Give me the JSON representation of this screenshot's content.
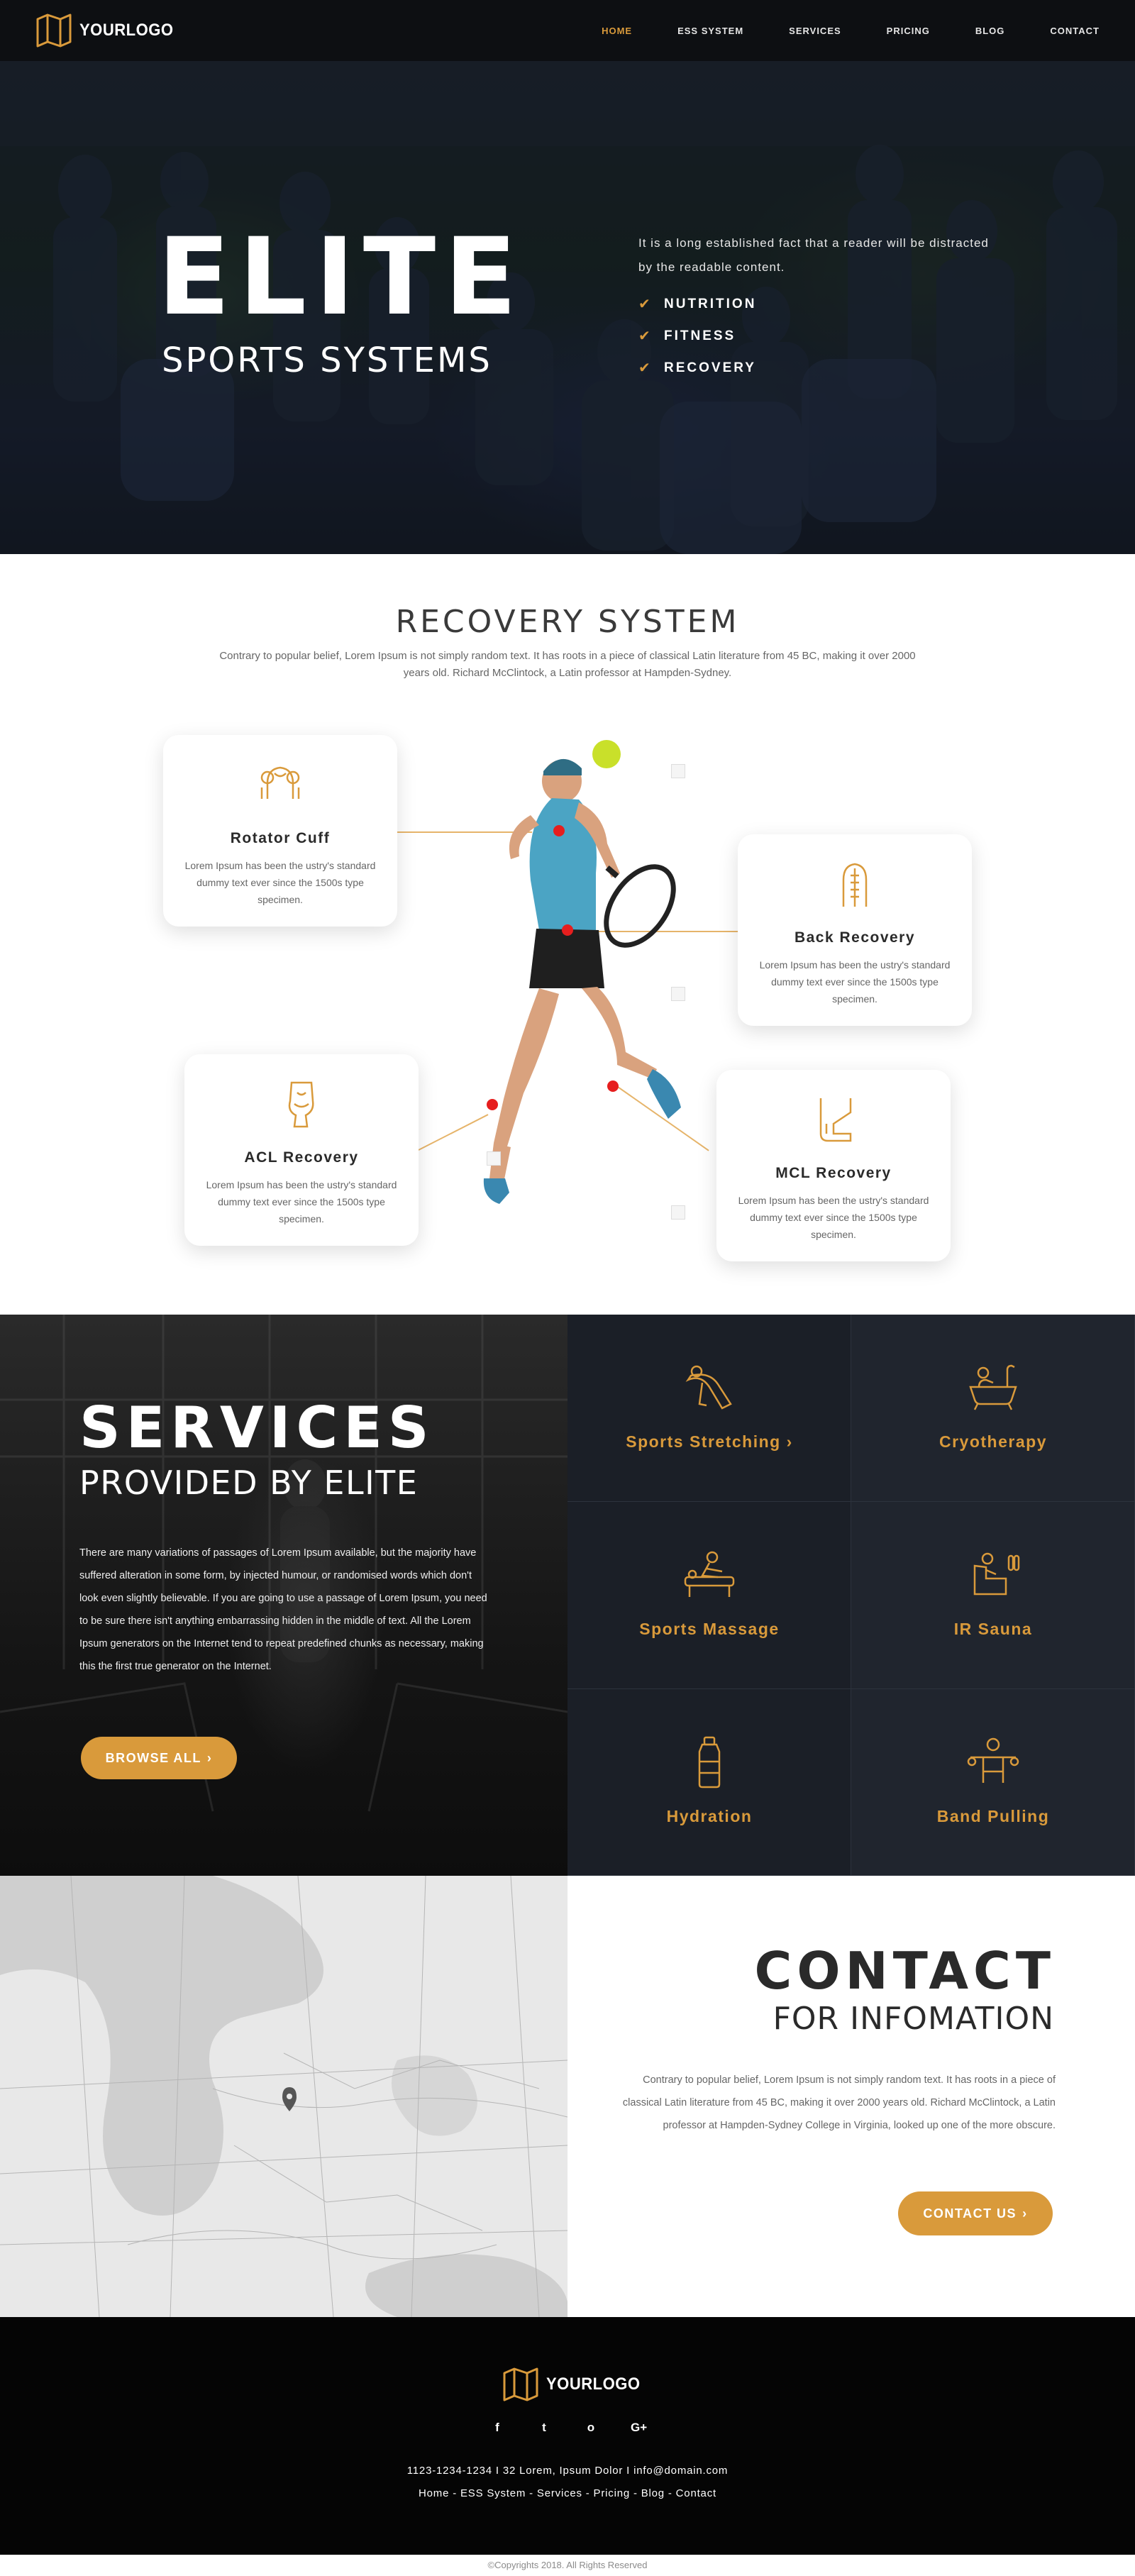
{
  "nav": {
    "logo": "YOURLOGO",
    "items": [
      "HOME",
      "ESS SYSTEM",
      "SERVICES",
      "PRICING",
      "BLOG",
      "CONTACT"
    ]
  },
  "hero": {
    "title": "ELITE",
    "subtitle": "SPORTS SYSTEMS",
    "text": "It is a long established fact that a reader will be distracted by the readable content.",
    "list": [
      "NUTRITION",
      "FITNESS",
      "RECOVERY"
    ]
  },
  "recovery": {
    "title": "RECOVERY SYSTEM",
    "description": "Contrary to popular belief, Lorem Ipsum is not simply random text. It has roots in a piece of classical Latin literature from 45 BC, making it over 2000 years old. Richard McClintock, a Latin professor at Hampden-Sydney.",
    "cards": [
      {
        "title": "Rotator Cuff",
        "text": "Lorem Ipsum has been the ustry's standard dummy text ever since the 1500s type specimen.",
        "icon": "shoulder-icon"
      },
      {
        "title": "Back Recovery",
        "text": "Lorem Ipsum has been the ustry's standard dummy text ever since the 1500s type specimen.",
        "icon": "back-icon"
      },
      {
        "title": "ACL Recovery",
        "text": "Lorem Ipsum has been the ustry's standard dummy text ever since the 1500s type specimen.",
        "icon": "knee-icon"
      },
      {
        "title": "MCL Recovery",
        "text": "Lorem Ipsum has been the ustry's standard dummy text ever since the 1500s type specimen.",
        "icon": "leg-icon"
      }
    ]
  },
  "services": {
    "title": "SERVICES",
    "subtitle": "PROVIDED BY ELITE",
    "description": "There are many variations of passages of Lorem Ipsum available, but the majority have suffered alteration in some form, by injected humour, or randomised words which don't look even slightly believable. If you are going to use a passage of Lorem Ipsum, you need to be sure there isn't anything embarrassing hidden in the middle of text. All the Lorem Ipsum generators on the Internet tend to repeat predefined chunks as necessary, making this the first true generator on the Internet.",
    "button": "BROWSE ALL",
    "items": [
      {
        "label": "Sports Stretching",
        "icon": "stretching-icon"
      },
      {
        "label": "Cryotherapy",
        "icon": "bathtub-icon"
      },
      {
        "label": "Sports Massage",
        "icon": "massage-icon"
      },
      {
        "label": "IR Sauna",
        "icon": "sauna-icon"
      },
      {
        "label": "Hydration",
        "icon": "bottle-icon"
      },
      {
        "label": "Band Pulling",
        "icon": "band-icon"
      }
    ]
  },
  "contact": {
    "title": "CONTACT",
    "subtitle": "FOR INFOMATION",
    "description": "Contrary to popular belief, Lorem Ipsum is not simply random text. It has roots in a piece of classical Latin literature from 45 BC, making it over 2000 years old. Richard McClintock, a Latin professor at Hampden-Sydney College in Virginia, looked up one of the more obscure.",
    "button": "CONTACT US"
  },
  "footer": {
    "logo": "YOURLOGO",
    "social": [
      "f",
      "t",
      "o",
      "G+"
    ],
    "info": "1123-1234-1234  I  32 Lorem, Ipsum Dolor  I  info@domain.com",
    "links": "Home - ESS System - Services - Pricing - Blog - Contact",
    "copyright": "©Copyrights 2018. All Rights Reserved"
  },
  "colors": {
    "accent": "#d99a3b",
    "dark": "#0d0f12",
    "panel": "#1b1f27"
  }
}
